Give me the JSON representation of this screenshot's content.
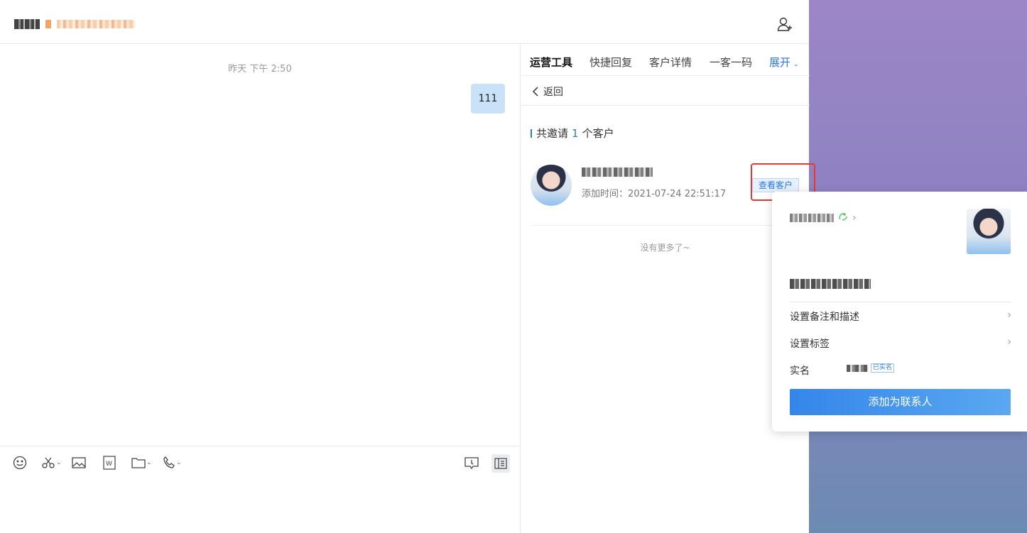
{
  "header": {
    "chat_title_prefix_icon": "blurred-name",
    "add_member_icon": "add-person-icon"
  },
  "chat": {
    "timestamp": "昨天 下午 2:50",
    "messages": [
      {
        "from": "self",
        "text": "111"
      }
    ]
  },
  "toolbar": {
    "icons": [
      "smile-icon",
      "scissors-icon",
      "image-icon",
      "word-file-icon",
      "folder-icon",
      "phone-icon"
    ],
    "right_icons": [
      "chat-record-icon",
      "split-view-icon"
    ]
  },
  "panel": {
    "tabs": [
      {
        "label": "运营工具",
        "active": true
      },
      {
        "label": "快捷回复"
      },
      {
        "label": "客户详情"
      },
      {
        "label": "一客一码"
      },
      {
        "label": "展开"
      }
    ],
    "back_label": "返回",
    "invite_prefix": "共邀请",
    "invite_count": "1",
    "invite_suffix": "个客户",
    "customer": {
      "added_label": "添加时间：",
      "added_time": "2021-07-24 22:51:17",
      "view_button": "查看客户"
    },
    "no_more": "没有更多了~"
  },
  "popup": {
    "wechat_icon": "wechat-icon",
    "remark_label": "设置备注和描述",
    "tag_label": "设置标签",
    "realname_label": "实名",
    "realname_badge": "已实名",
    "add_button": "添加为联系人"
  },
  "colors": {
    "accent": "#2a79e6",
    "highlight": "#e63a2e",
    "bubble": "#c9e2f8"
  }
}
